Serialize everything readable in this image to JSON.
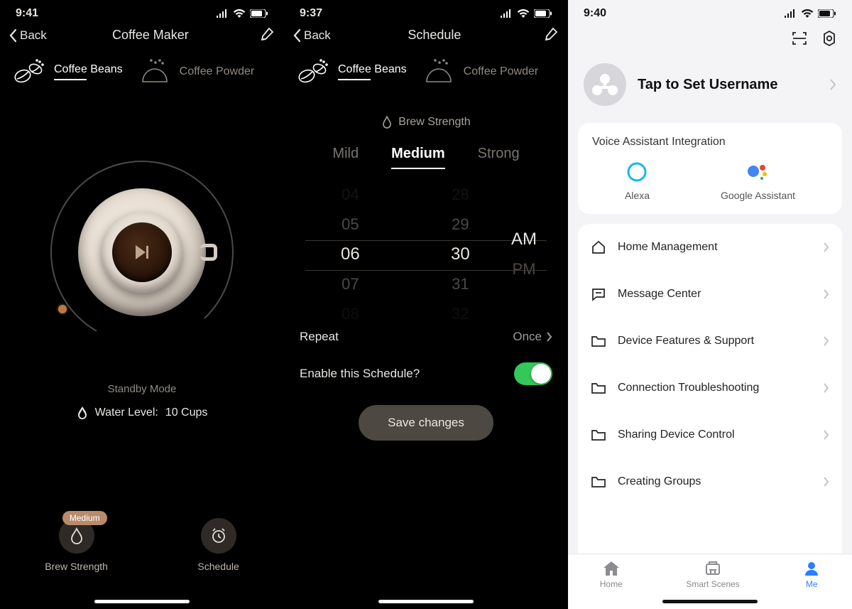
{
  "screens": {
    "coffee": {
      "time": "9:41",
      "back": "Back",
      "title": "Coffee Maker",
      "tabs": {
        "beans": "Coffee Beans",
        "powder": "Coffee Powder"
      },
      "status": "Standby Mode",
      "water_label": "Water Level:",
      "water_value": "10 Cups",
      "brew_label": "Brew Strength",
      "brew_badge": "Medium",
      "schedule_label": "Schedule"
    },
    "schedule": {
      "time": "9:37",
      "back": "Back",
      "title": "Schedule",
      "tabs": {
        "beans": "Coffee Beans",
        "powder": "Coffee Powder"
      },
      "section_label": "Brew Strength",
      "strengths": {
        "mild": "Mild",
        "medium": "Medium",
        "strong": "Strong"
      },
      "picker": {
        "hours": [
          "04",
          "05",
          "06",
          "07",
          "08"
        ],
        "minutes": [
          "28",
          "29",
          "30",
          "31",
          "32"
        ],
        "ampm": [
          "AM",
          "PM"
        ],
        "selected": {
          "hour": "06",
          "minute": "30",
          "ampm": "AM"
        }
      },
      "repeat_label": "Repeat",
      "repeat_value": "Once",
      "enable_label": "Enable this Schedule?",
      "save_label": "Save changes"
    },
    "me": {
      "time": "9:40",
      "profile_title": "Tap to Set Username",
      "voice_card_title": "Voice Assistant Integration",
      "voice": {
        "alexa": "Alexa",
        "google": "Google Assistant"
      },
      "menu": [
        "Home Management",
        "Message Center",
        "Device Features & Support",
        "Connection Troubleshooting",
        "Sharing Device Control",
        "Creating Groups"
      ],
      "tabs": {
        "home": "Home",
        "scenes": "Smart Scenes",
        "me": "Me"
      }
    }
  }
}
